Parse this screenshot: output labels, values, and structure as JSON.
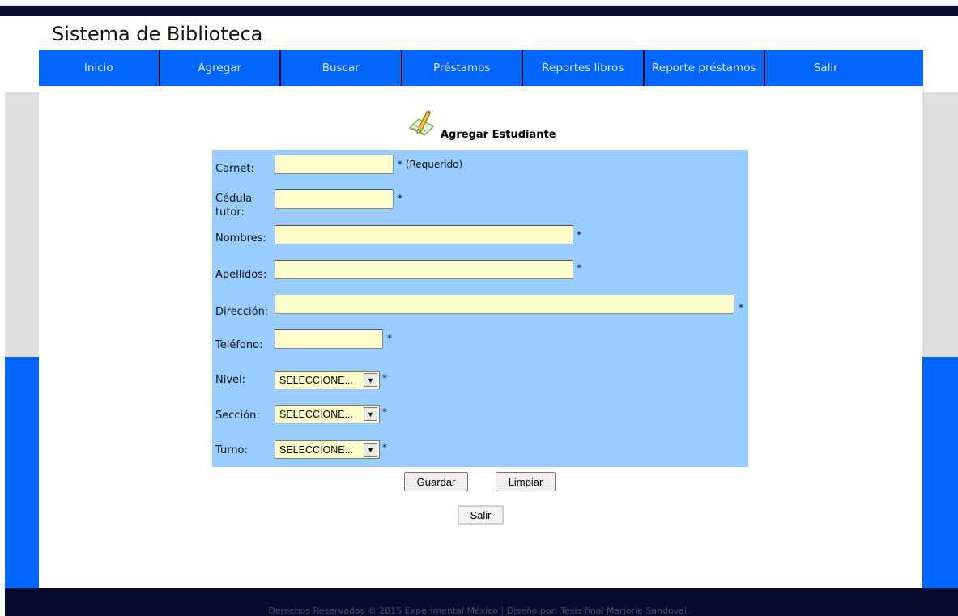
{
  "site": {
    "title": "Sistema de Biblioteca"
  },
  "nav": {
    "items": [
      "Inicio",
      "Agregar",
      "Buscar",
      "Préstamos",
      "Reportes libros",
      "Reporte préstamos",
      "Salir"
    ]
  },
  "form": {
    "icon": "edit-document-icon",
    "title": "Agregar Estudiante",
    "fields": {
      "carnet": {
        "label": "Carnet:",
        "value": "",
        "req": "* (Requerido)"
      },
      "cedula": {
        "label": "Cédula tutor:",
        "value": "",
        "req": "*"
      },
      "nombres": {
        "label": "Nombres:",
        "value": "",
        "req": "*"
      },
      "apellidos": {
        "label": "Apellidos:",
        "value": "",
        "req": "*"
      },
      "direccion": {
        "label": "Dirección:",
        "value": "",
        "req": "*"
      },
      "telefono": {
        "label": "Teléfono:",
        "value": "",
        "req": "*"
      },
      "nivel": {
        "label": "Nivel:",
        "selected": "SELECCIONE...",
        "req": "*"
      },
      "seccion": {
        "label": "Sección:",
        "selected": "SELECCIONE...",
        "req": "*"
      },
      "turno": {
        "label": "Turno:",
        "selected": "SELECCIONE...",
        "req": "*"
      }
    },
    "buttons": {
      "save": "Guardar",
      "clear": "Limpiar",
      "exit": "Salir"
    }
  },
  "footer": {
    "text": "Derechos Reservados © 2015 Experimental México | Diseño por: Tesis final Marjorie Sandoval."
  },
  "colors": {
    "nav": "#0066ff",
    "panel": "#99ccff",
    "input": "#ffffcc",
    "dark": "#0b0b33"
  }
}
